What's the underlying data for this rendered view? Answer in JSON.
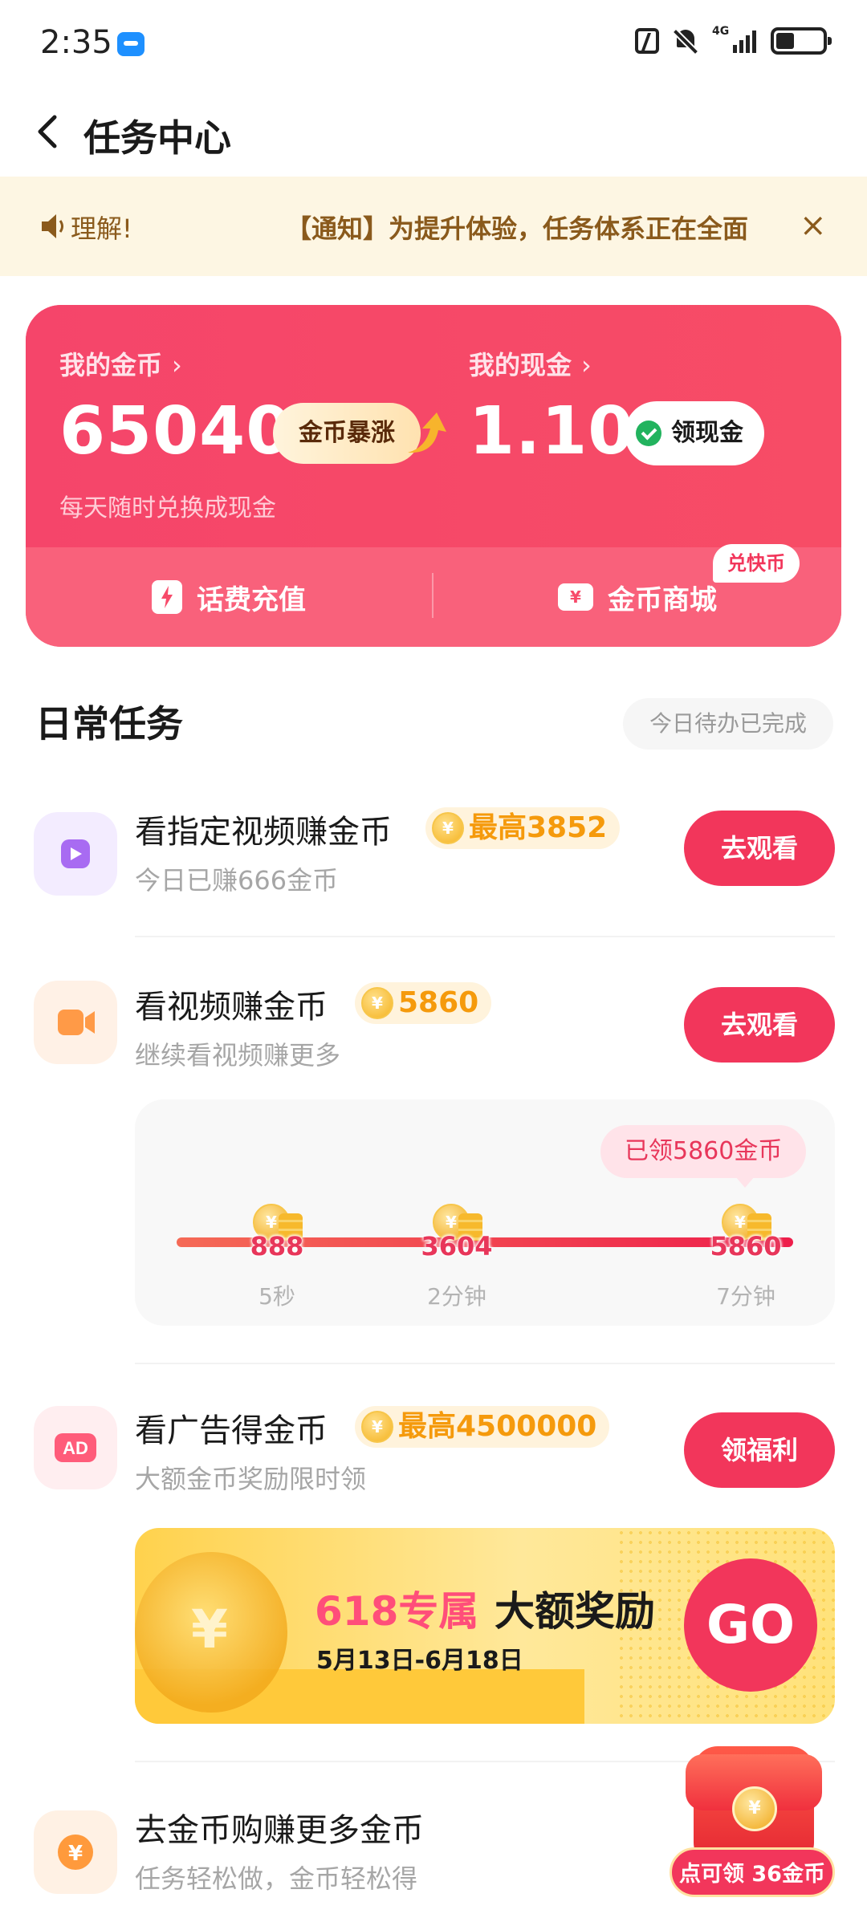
{
  "status_bar": {
    "time": "2:35",
    "network": "4G"
  },
  "header": {
    "title": "任务中心"
  },
  "notice": {
    "left_fragment": "理解!",
    "text": "【通知】为提升体验，任务体系正在全面",
    "close_glyph": "×"
  },
  "wallet": {
    "coins_label": "我的金币",
    "coins_value": "65040",
    "surge_label": "金币暴涨",
    "cash_label": "我的现金",
    "cash_value": "1.10",
    "claim_cash_label": "领现金",
    "subtitle": "每天随时兑换成现金",
    "phone_topup_label": "话费充值",
    "mall_label": "金币商城",
    "quick_badge": "兑快币",
    "chevron": "›"
  },
  "daily_tasks": {
    "title": "日常任务",
    "status": "今日待办已完成"
  },
  "tasks": [
    {
      "title": "看指定视频赚金币",
      "reward": "最高3852",
      "subtitle": "今日已赚666金币",
      "action": "去观看"
    },
    {
      "title": "看视频赚金币",
      "reward": "5860",
      "subtitle": "继续看视频赚更多",
      "action": "去观看"
    },
    {
      "title": "看广告得金币",
      "reward": "最高4500000",
      "subtitle": "大额金币奖励限时领",
      "action": "领福利"
    },
    {
      "title": "去金币购赚更多金币",
      "subtitle": "任务轻松做，金币轻松得"
    }
  ],
  "progress": {
    "claimed": "已领5860金币",
    "milestones": [
      {
        "value": "888",
        "time": "5秒"
      },
      {
        "value": "3604",
        "time": "2分钟"
      },
      {
        "value": "5860",
        "time": "7分钟"
      }
    ]
  },
  "ad_banner": {
    "title_highlight": "618专属",
    "title_main": "大额奖励",
    "date_range": "5月13日-6月18日",
    "go_label": "GO"
  },
  "floating_gift": {
    "badge": "点可领 36金币"
  },
  "colors": {
    "primary": "#f2365b",
    "wallet_bg": "#f74a6a",
    "gold": "#f59a0c",
    "notice_bg": "#fdf6e3"
  },
  "icons": {
    "back": "chevron-left-icon",
    "speaker": "speaker-icon",
    "close": "close-icon",
    "play": "play-icon",
    "video": "video-camera-icon",
    "ad": "ad-icon",
    "yen": "yen-coin-icon",
    "bolt": "lightning-icon",
    "ticket": "ticket-icon",
    "wechat": "wechat-check-icon",
    "gift": "gift-box-icon"
  }
}
